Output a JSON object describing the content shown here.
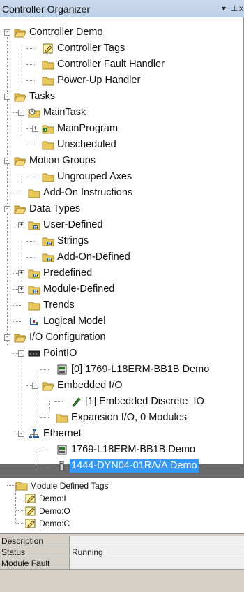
{
  "window": {
    "title": "Controller Organizer",
    "pin_glyph": "▾ ⊥",
    "close_glyph": "x"
  },
  "tree": [
    {
      "id": "controller",
      "label": "Controller Demo",
      "icon": "folder-open",
      "expander": "-"
    },
    {
      "id": "controller-tags",
      "label": "Controller Tags",
      "icon": "tags"
    },
    {
      "id": "fault-handler",
      "label": "Controller Fault Handler",
      "icon": "folder"
    },
    {
      "id": "powerup-handler",
      "label": "Power-Up Handler",
      "icon": "folder"
    },
    {
      "id": "tasks",
      "label": "Tasks",
      "icon": "folder-open",
      "expander": "-"
    },
    {
      "id": "maintask",
      "label": "MainTask",
      "icon": "task",
      "expander": "-"
    },
    {
      "id": "mainprogram",
      "label": "MainProgram",
      "icon": "program",
      "expander": "+"
    },
    {
      "id": "unscheduled",
      "label": "Unscheduled",
      "icon": "folder"
    },
    {
      "id": "motion-groups",
      "label": "Motion Groups",
      "icon": "folder-open",
      "expander": "-"
    },
    {
      "id": "ungrouped-axes",
      "label": "Ungrouped Axes",
      "icon": "folder"
    },
    {
      "id": "aoi",
      "label": "Add-On Instructions",
      "icon": "folder"
    },
    {
      "id": "data-types",
      "label": "Data Types",
      "icon": "folder-open",
      "expander": "-"
    },
    {
      "id": "user-defined",
      "label": "User-Defined",
      "icon": "datatype",
      "expander": "+"
    },
    {
      "id": "strings",
      "label": "Strings",
      "icon": "datatype"
    },
    {
      "id": "addon-defined",
      "label": "Add-On-Defined",
      "icon": "datatype"
    },
    {
      "id": "predefined",
      "label": "Predefined",
      "icon": "datatype",
      "expander": "+"
    },
    {
      "id": "module-defined",
      "label": "Module-Defined",
      "icon": "datatype",
      "expander": "+"
    },
    {
      "id": "trends",
      "label": "Trends",
      "icon": "folder"
    },
    {
      "id": "logical-model",
      "label": "Logical Model",
      "icon": "logical"
    },
    {
      "id": "io-config",
      "label": "I/O Configuration",
      "icon": "folder-open",
      "expander": "-"
    },
    {
      "id": "pointio",
      "label": "PointIO",
      "icon": "backplane",
      "expander": "-"
    },
    {
      "id": "slot0",
      "label": "[0] 1769-L18ERM-BB1B Demo",
      "icon": "module"
    },
    {
      "id": "embedded-io",
      "label": "Embedded I/O",
      "icon": "folder-open",
      "expander": "-"
    },
    {
      "id": "embedded-discrete",
      "label": "[1] Embedded Discrete_IO",
      "icon": "discrete"
    },
    {
      "id": "expansion-io",
      "label": "Expansion I/O, 0 Modules",
      "icon": "folder"
    },
    {
      "id": "ethernet",
      "label": "Ethernet",
      "icon": "network",
      "expander": "-"
    },
    {
      "id": "eth-controller",
      "label": "1769-L18ERM-BB1B Demo",
      "icon": "module"
    },
    {
      "id": "eth-dyn",
      "label": "1444-DYN04-01RA/A Demo",
      "icon": "device",
      "selected": true
    }
  ],
  "tags_panel": {
    "folder_label": "Module Defined Tags",
    "items": [
      "Demo:I",
      "Demo:O",
      "Demo:C"
    ]
  },
  "properties": [
    {
      "name": "Description",
      "value": ""
    },
    {
      "name": "Status",
      "value": "Running"
    },
    {
      "name": "Module Fault",
      "value": ""
    }
  ],
  "colors": {
    "selection": "#3399ff",
    "folder": "#e8c85a",
    "title_bar": "#c7d7ec"
  }
}
